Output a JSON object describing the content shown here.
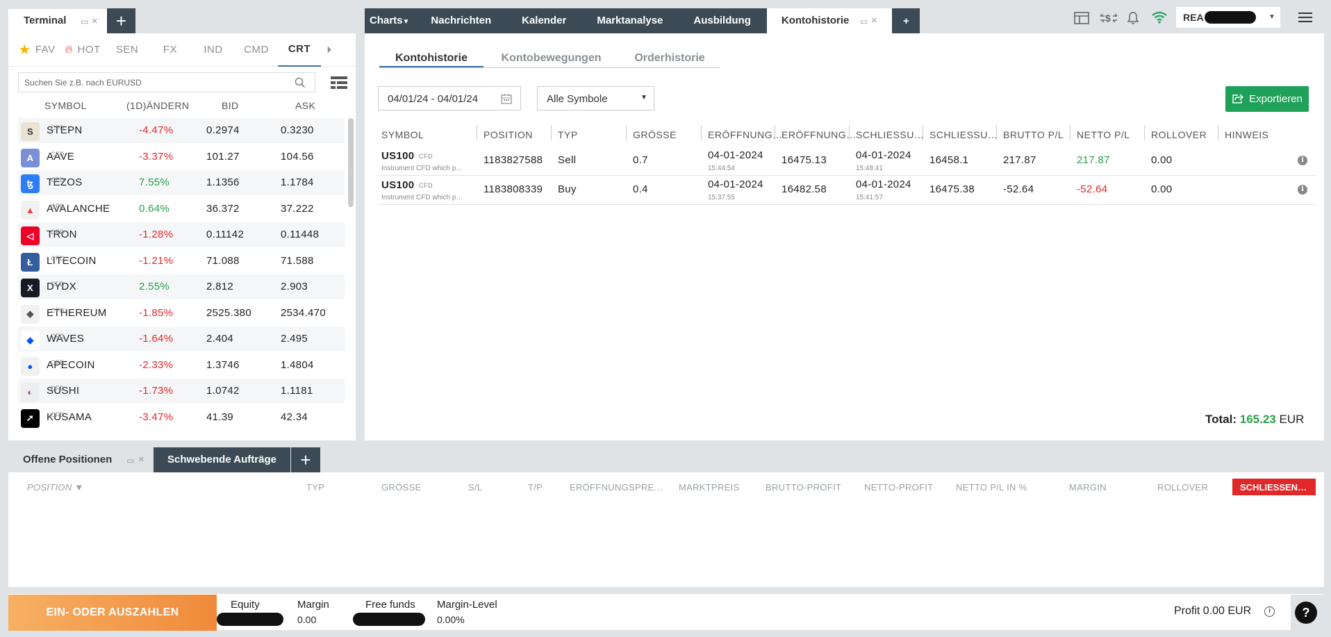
{
  "terminal": {
    "tab_label": "Terminal",
    "categories": [
      {
        "label": "FAV",
        "icon": "star-icon"
      },
      {
        "label": "HOT",
        "icon": "fire-icon"
      },
      {
        "label": "SEN"
      },
      {
        "label": "FX"
      },
      {
        "label": "IND"
      },
      {
        "label": "CMD"
      },
      {
        "label": "CRT"
      }
    ],
    "active_category": "CRT",
    "search_placeholder": "Suchen Sie z.B. nach EURUSD",
    "columns": [
      "SYMBOL",
      "(1D)ÄNDERN",
      "BID",
      "ASK"
    ],
    "rows": [
      {
        "symbol": "STEPN",
        "tag": "CFD",
        "change": "-4.47%",
        "bid": "0.2974",
        "ask": "0.3230",
        "dir": "neg",
        "color": "#e9e3d4",
        "fg": "#333",
        "glyph": "S"
      },
      {
        "symbol": "AAVE",
        "tag": "CFD",
        "change": "-3.37%",
        "bid": "101.27",
        "ask": "104.56",
        "dir": "neg",
        "color": "#7b8fd6",
        "fg": "#fff",
        "glyph": "A"
      },
      {
        "symbol": "TEZOS",
        "tag": "CFD",
        "change": "7.55%",
        "bid": "1.1356",
        "ask": "1.1784",
        "dir": "pos",
        "color": "#2c7df7",
        "fg": "#fff",
        "glyph": "ꜩ"
      },
      {
        "symbol": "AVALANCHE",
        "tag": "CFD",
        "change": "0.64%",
        "bid": "36.372",
        "ask": "37.222",
        "dir": "pos",
        "color": "#f1f1f1",
        "fg": "#e84142",
        "glyph": "▲"
      },
      {
        "symbol": "TRON",
        "tag": "CFD",
        "change": "-1.28%",
        "bid": "0.11142",
        "ask": "0.11448",
        "dir": "neg",
        "color": "#ef0027",
        "fg": "#fff",
        "glyph": "◁"
      },
      {
        "symbol": "LITECOIN",
        "tag": "CFD",
        "change": "-1.21%",
        "bid": "71.088",
        "ask": "71.588",
        "dir": "neg",
        "color": "#345d9d",
        "fg": "#fff",
        "glyph": "Ł"
      },
      {
        "symbol": "DYDX",
        "tag": "CFD",
        "change": "2.55%",
        "bid": "2.812",
        "ask": "2.903",
        "dir": "pos",
        "color": "#1a1a27",
        "fg": "#fff",
        "glyph": "X"
      },
      {
        "symbol": "ETHEREUM",
        "tag": "CFD",
        "change": "-1.85%",
        "bid": "2525.380",
        "ask": "2534.470",
        "dir": "neg",
        "color": "#f1f1f1",
        "fg": "#555",
        "glyph": "◆"
      },
      {
        "symbol": "WAVES",
        "tag": "CFD",
        "change": "-1.64%",
        "bid": "2.404",
        "ask": "2.495",
        "dir": "neg",
        "color": "#fff",
        "fg": "#0155ff",
        "glyph": "◆"
      },
      {
        "symbol": "APECOIN",
        "tag": "CFD",
        "change": "-2.33%",
        "bid": "1.3746",
        "ask": "1.4804",
        "dir": "neg",
        "color": "#f1f1f1",
        "fg": "#0054f9",
        "glyph": "●"
      },
      {
        "symbol": "SUSHI",
        "tag": "CFD",
        "change": "-1.73%",
        "bid": "1.0742",
        "ask": "1.1181",
        "dir": "neg",
        "color": "#eee",
        "fg": "#8d3f91",
        "glyph": "◐"
      },
      {
        "symbol": "KUSAMA",
        "tag": "CFD",
        "change": "-3.47%",
        "bid": "41.39",
        "ask": "42.34",
        "dir": "neg",
        "color": "#000",
        "fg": "#fff",
        "glyph": "➚"
      }
    ]
  },
  "topnav": {
    "items": [
      "Charts",
      "Nachrichten",
      "Kalender",
      "Marktanalyse",
      "Ausbildung",
      "Kontohistorie"
    ],
    "active": "Kontohistorie"
  },
  "account": {
    "label": "REA"
  },
  "history": {
    "tabs": [
      "Kontohistorie",
      "Kontobewegungen",
      "Orderhistorie"
    ],
    "date_range": "04/01/24 - 04/01/24",
    "symbol_filter": "Alle Symbole",
    "export_label": "Exportieren",
    "columns": [
      "SYMBOL",
      "POSITION",
      "TYP",
      "GRÖSSE",
      "ERÖFFNUNG…",
      "ERÖFFNUNG…",
      "SCHLIESSU…",
      "SCHLIESSU…",
      "BRUTTO P/L",
      "NETTO P/L",
      "ROLLOVER",
      "HINWEIS"
    ],
    "rows": [
      {
        "symbol": "US100",
        "tag": "CFD",
        "desc": "Instrument CFD which p…",
        "position": "1183827588",
        "type": "Sell",
        "size": "0.7",
        "open_date": "04-01-2024",
        "open_time": "15:44:54",
        "open_price": "16475.13",
        "close_date": "04-01-2024",
        "close_time": "15:48:41",
        "close_price": "16458.1",
        "gross": "217.87",
        "net": "217.87",
        "net_dir": "pos",
        "rollover": "0.00"
      },
      {
        "symbol": "US100",
        "tag": "CFD",
        "desc": "Instrument CFD which p…",
        "position": "1183808339",
        "type": "Buy",
        "size": "0.4",
        "open_date": "04-01-2024",
        "open_time": "15:37:55",
        "open_price": "16482.58",
        "close_date": "04-01-2024",
        "close_time": "15:41:57",
        "close_price": "16475.38",
        "gross": "-52.64",
        "net": "-52.64",
        "net_dir": "neg",
        "rollover": "0.00"
      }
    ],
    "total_label": "Total:",
    "total_value": "165.23",
    "total_currency": "EUR"
  },
  "bottom": {
    "tabs": [
      "Offene Positionen",
      "Schwebende Aufträge"
    ],
    "columns": [
      "POSITION ▼",
      "TYP",
      "GRÖSSE",
      "S/L",
      "T/P",
      "ERÖFFNUNGSPRE…",
      "MARKTPREIS",
      "BRUTTO-PROFIT",
      "NETTO-PROFIT",
      "NETTO P/L IN %",
      "MARGIN",
      "ROLLOVER"
    ],
    "close_all": "SCHLIESSEN…"
  },
  "footer": {
    "deposit": "EIN- ODER AUSZAHLEN",
    "equity_label": "Equity",
    "margin_label": "Margin",
    "margin_value": "0.00",
    "free_label": "Free funds",
    "level_label": "Margin-Level",
    "level_value": "0.00%",
    "profit_label": "Profit",
    "profit_value": "0.00 EUR",
    "help": "?"
  },
  "colors": {
    "accent": "#3b6ea8",
    "dark": "#3b4a54",
    "green": "#27a048",
    "red": "#e02828",
    "export": "#1fa15a",
    "deposit": "#f39b4c"
  }
}
